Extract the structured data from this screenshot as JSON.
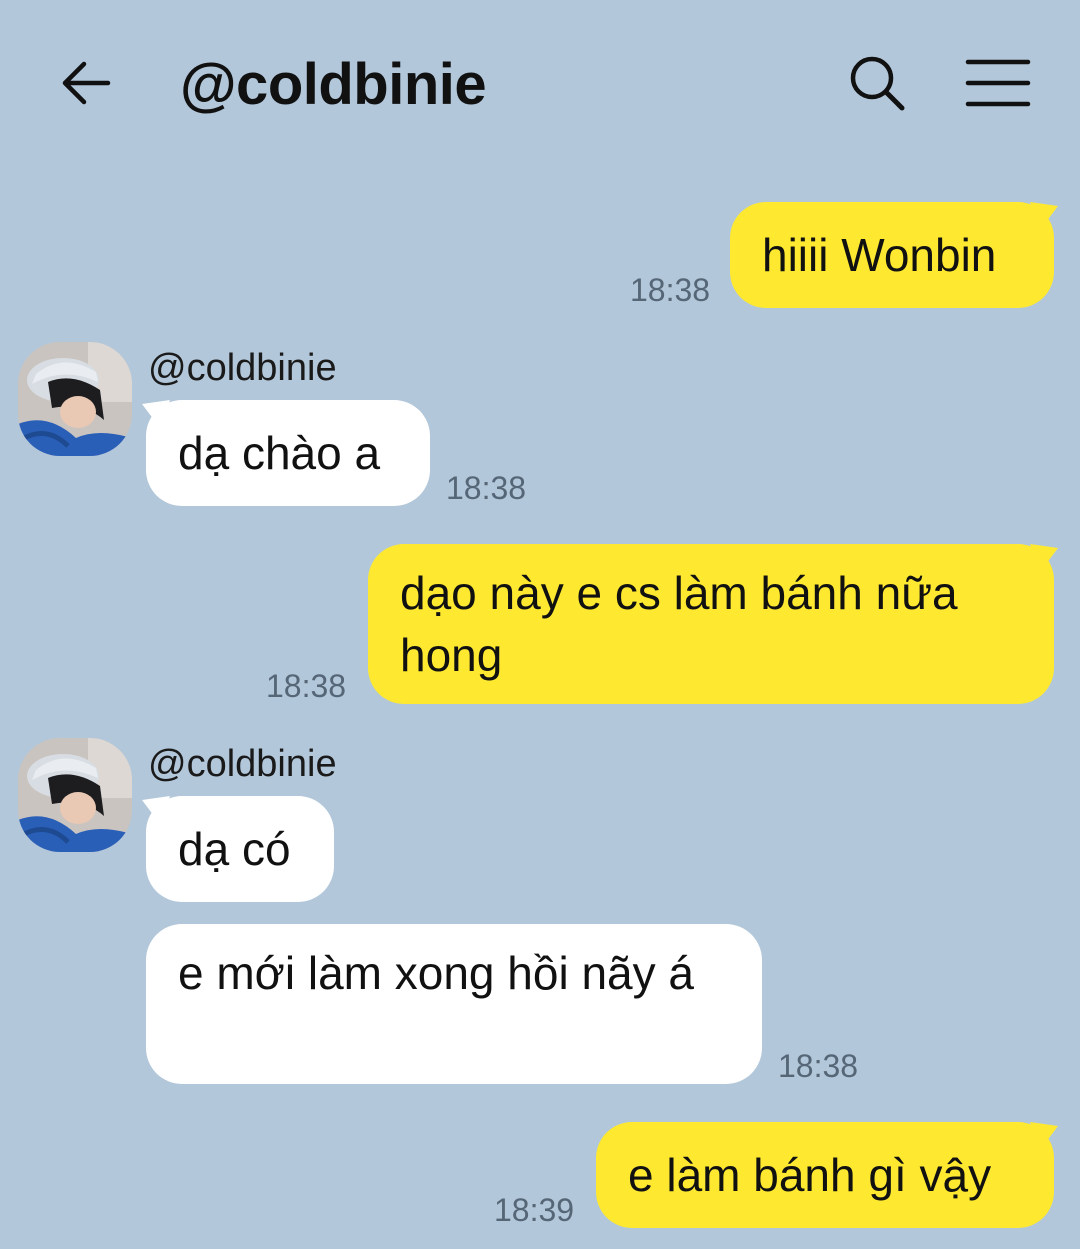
{
  "header": {
    "title": "@coldbinie"
  },
  "icons": {
    "back": "arrow-left-icon",
    "search": "search-icon",
    "menu": "menu-icon"
  },
  "colors": {
    "background": "#b2c7da",
    "outgoing_bubble": "#fee930",
    "incoming_bubble": "#ffffff"
  },
  "messages": [
    {
      "from": "me",
      "text": "hiiii Wonbin",
      "time": "18:38"
    },
    {
      "from": "them",
      "sender": "@coldbinie",
      "text": "dạ chào a",
      "time": "18:38"
    },
    {
      "from": "me",
      "text": "dạo này e cs làm bánh nữa hong",
      "time": "18:38"
    },
    {
      "from": "them",
      "sender": "@coldbinie",
      "text": "dạ có",
      "time": ""
    },
    {
      "from": "them",
      "text": "e mới làm xong hồi nãy á",
      "time": "18:38"
    },
    {
      "from": "me",
      "text": "e làm bánh gì vậy",
      "time": "18:39"
    }
  ]
}
